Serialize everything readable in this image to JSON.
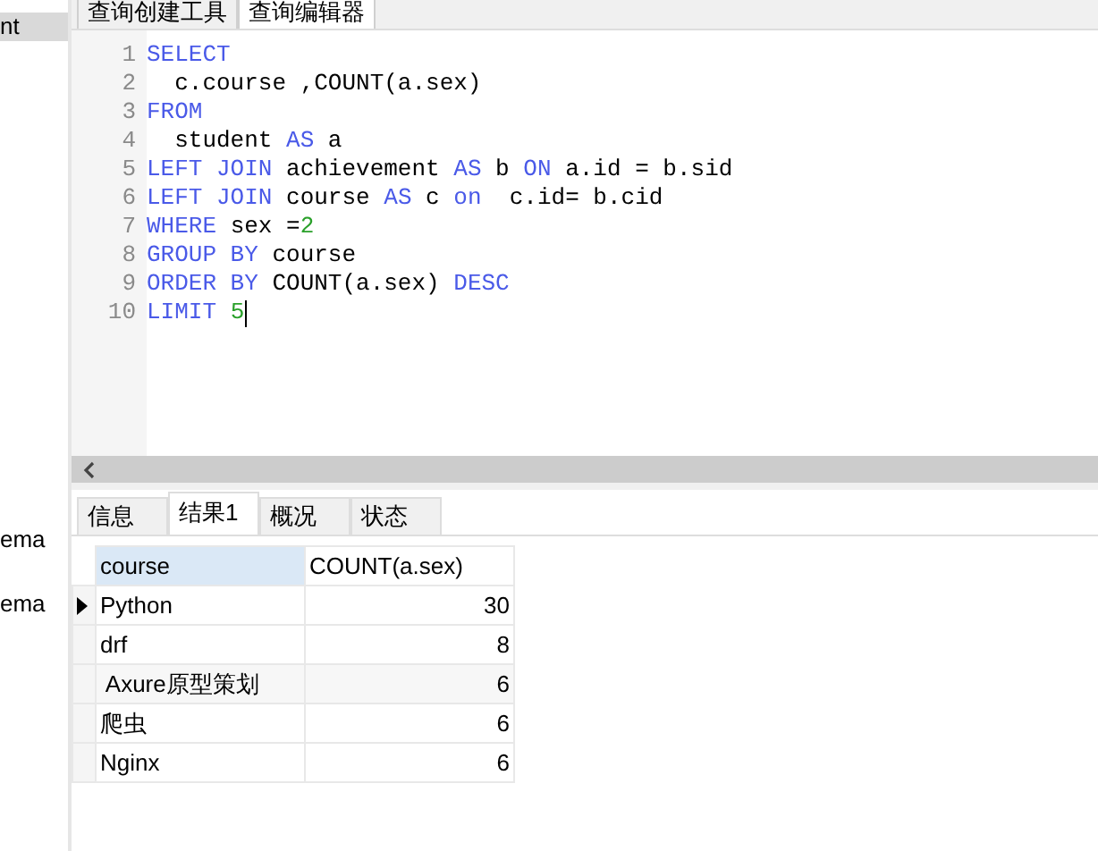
{
  "sidebar": {
    "items": [
      {
        "label": "nt",
        "selected": true
      },
      {
        "label": "ema",
        "selected": false
      },
      {
        "label": "ema",
        "selected": false
      }
    ]
  },
  "editor_tabs": [
    {
      "label": "查询创建工具",
      "selected": false
    },
    {
      "label": "查询编辑器",
      "selected": true
    }
  ],
  "editor": {
    "lines": [
      {
        "number": "1",
        "tokens": [
          {
            "kind": "keyword",
            "text": "SELECT"
          }
        ]
      },
      {
        "number": "2",
        "tokens": [
          {
            "kind": "plain",
            "text": "  c.course ,COUNT(a.sex)"
          }
        ]
      },
      {
        "number": "3",
        "tokens": [
          {
            "kind": "keyword",
            "text": "FROM"
          }
        ]
      },
      {
        "number": "4",
        "tokens": [
          {
            "kind": "plain",
            "text": "  student "
          },
          {
            "kind": "keyword",
            "text": "AS"
          },
          {
            "kind": "plain",
            "text": " a"
          }
        ]
      },
      {
        "number": "5",
        "tokens": [
          {
            "kind": "keyword",
            "text": "LEFT JOIN"
          },
          {
            "kind": "plain",
            "text": " achievement "
          },
          {
            "kind": "keyword",
            "text": "AS"
          },
          {
            "kind": "plain",
            "text": " b "
          },
          {
            "kind": "keyword",
            "text": "ON"
          },
          {
            "kind": "plain",
            "text": " a.id = b.sid"
          }
        ]
      },
      {
        "number": "6",
        "tokens": [
          {
            "kind": "keyword",
            "text": "LEFT JOIN"
          },
          {
            "kind": "plain",
            "text": " course "
          },
          {
            "kind": "keyword",
            "text": "AS"
          },
          {
            "kind": "plain",
            "text": " c "
          },
          {
            "kind": "keyword",
            "text": "on"
          },
          {
            "kind": "plain",
            "text": "  c.id= b.cid"
          }
        ]
      },
      {
        "number": "7",
        "tokens": [
          {
            "kind": "keyword",
            "text": "WHERE"
          },
          {
            "kind": "plain",
            "text": " sex ="
          },
          {
            "kind": "number",
            "text": "2"
          }
        ]
      },
      {
        "number": "8",
        "tokens": [
          {
            "kind": "keyword",
            "text": "GROUP BY"
          },
          {
            "kind": "plain",
            "text": " course"
          }
        ]
      },
      {
        "number": "9",
        "tokens": [
          {
            "kind": "keyword",
            "text": "ORDER BY"
          },
          {
            "kind": "plain",
            "text": " COUNT(a.sex) "
          },
          {
            "kind": "keyword",
            "text": "DESC"
          }
        ]
      },
      {
        "number": "10",
        "cursor": true,
        "tokens": [
          {
            "kind": "keyword",
            "text": "LIMIT"
          },
          {
            "kind": "number",
            "text": " 5"
          }
        ]
      }
    ]
  },
  "result_tabs": [
    {
      "label": "信息",
      "selected": false
    },
    {
      "label": "结果1",
      "selected": true
    },
    {
      "label": "概况",
      "selected": false
    },
    {
      "label": "状态",
      "selected": false
    }
  ],
  "table": {
    "columns": [
      "course",
      "COUNT(a.sex)"
    ],
    "rows": [
      {
        "current": true,
        "cells": [
          "Python",
          "30"
        ]
      },
      {
        "current": false,
        "cells": [
          "drf",
          "8"
        ]
      },
      {
        "current": false,
        "cells": [
          " Axure原型策划",
          "6"
        ]
      },
      {
        "current": false,
        "cells": [
          "爬虫",
          "6"
        ]
      },
      {
        "current": false,
        "cells": [
          "Nginx",
          "6"
        ]
      }
    ]
  }
}
